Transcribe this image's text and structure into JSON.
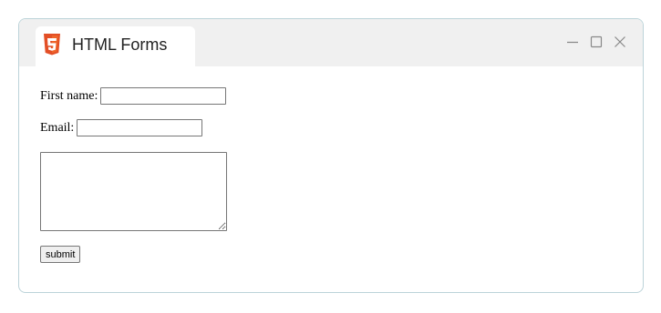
{
  "window": {
    "tab_title": "HTML Forms",
    "icon": "html5-icon",
    "controls": [
      "minimize-icon",
      "maximize-icon",
      "close-icon"
    ]
  },
  "form": {
    "first_name_label": "First name:",
    "first_name_value": "",
    "email_label": "Email:",
    "email_value": "",
    "textarea_value": "",
    "submit_label": "submit"
  },
  "colors": {
    "html5_orange": "#e34f26",
    "titlebar": "#f0f0f0",
    "window_border": "#bcd3d9"
  }
}
